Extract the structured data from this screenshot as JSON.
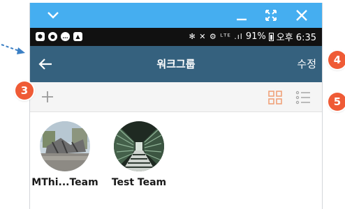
{
  "app": {
    "title": "워크그룹",
    "edit_label": "수정"
  },
  "statusbar": {
    "left_icons": [
      "app-icon",
      "circle-icon",
      "chat-icon",
      "image-icon"
    ],
    "network_glyphs": "✻ ✕ ⚙ ᴸᵀᴱ .ıl",
    "battery_percent": "91%",
    "time": "오후 6:35"
  },
  "toolbar": {
    "add_icon": "plus-icon",
    "view_modes": [
      "grid-view-icon",
      "list-view-icon"
    ],
    "active_view": "grid"
  },
  "teams": [
    {
      "name": "MThi...Team"
    },
    {
      "name": "Test Team"
    }
  ],
  "callouts": {
    "add": "3",
    "edit": "4",
    "view_toggle": "5"
  },
  "colors": {
    "window_titlebar": "#45aef0",
    "header": "#35617e",
    "callout": "#ef5b36",
    "active_view": "#f0a27a"
  }
}
